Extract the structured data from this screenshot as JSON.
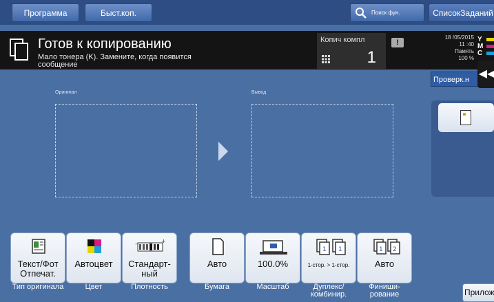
{
  "topbar": {
    "program": "Программа",
    "fastcopy": "Быст.коп.",
    "search": "Поиск фун.",
    "jobs": "СписокЗаданий"
  },
  "status": {
    "title": "Готов к копированию",
    "message": "Мало тонера (K). Замените, когда появится сообщение",
    "copies_label": "Копич компл",
    "copies_value": "1",
    "date": "18 /05/2015",
    "time": "11 :40",
    "memory_label": "Память",
    "memory_value": "100 %",
    "toner": [
      "Y",
      "M",
      "C"
    ],
    "check_label": "Проверк.н"
  },
  "main": {
    "original_label": "Оригинал",
    "output_label": "Вывод"
  },
  "functions": [
    {
      "value": "Текст/Фот Отпечат.",
      "caption": "Тип оригинала"
    },
    {
      "value": "Автоцвет",
      "caption": "Цвет"
    },
    {
      "value": "Стандарт-ный",
      "caption": "Плотность"
    },
    {
      "value": "Авто",
      "caption": "Бумага"
    },
    {
      "value": "100.0%",
      "caption": "Масштаб"
    },
    {
      "value": "1-стор. > 1-стор.",
      "caption": "Дуплекс/ комбинир."
    },
    {
      "value": "Авто",
      "caption": "Финиши-рование"
    }
  ],
  "apps_label": "Приложение",
  "colors": {
    "background": "#4a6fa3",
    "topbar": "#2d4d84",
    "statusbar": "#141414"
  }
}
